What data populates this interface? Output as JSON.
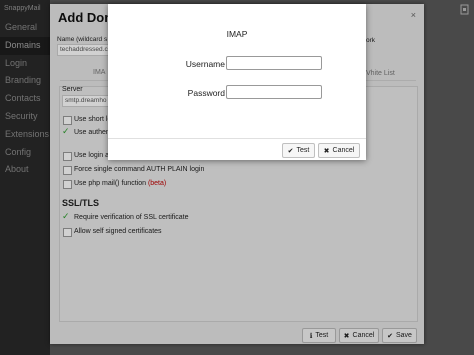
{
  "app": {
    "brand": "SnappyMail"
  },
  "sidebar": {
    "items": [
      {
        "label": "General"
      },
      {
        "label": "Domains"
      },
      {
        "label": "Login"
      },
      {
        "label": "Branding"
      },
      {
        "label": "Contacts"
      },
      {
        "label": "Security"
      },
      {
        "label": "Extensions"
      },
      {
        "label": "Config"
      },
      {
        "label": "About"
      }
    ]
  },
  "domain_dialog": {
    "title": "Add Doma",
    "close": "×",
    "name_label": "Name (wildcard s",
    "name_label_tail": "ork",
    "name_value": "techaddressed.c",
    "tab_left": "IMA",
    "tab_right": "Vhite List",
    "server_label": "Server",
    "server_value": "smtp.dreamho",
    "options": [
      {
        "label": "Use short lo",
        "checked": false
      },
      {
        "label": "Use authent",
        "checked": true
      },
      {
        "label": "Use login as",
        "checked": false
      },
      {
        "label": "Force single command AUTH PLAIN login",
        "checked": false
      },
      {
        "label": "Use php mail() function",
        "checked": false,
        "badge": "(beta)"
      }
    ],
    "ssl_heading": "SSL/TLS",
    "ssl_options": [
      {
        "label": "Require verification of SSL certificate",
        "checked": true
      },
      {
        "label": "Allow self signed certificates",
        "checked": false
      }
    ],
    "buttons": {
      "test": "Test",
      "cancel": "Cancel",
      "save": "Save"
    },
    "icons": {
      "test": "info-icon",
      "cancel": "close-icon",
      "save": "check-icon"
    }
  },
  "imap_modal": {
    "title": "IMAP",
    "username_label": "Username",
    "username_value": "",
    "password_label": "Password",
    "password_value": "",
    "buttons": {
      "test": "Test",
      "cancel": "Cancel"
    },
    "icons": {
      "test": "check-icon",
      "cancel": "close-icon"
    }
  },
  "colors": {
    "check_green": "#2f9e2f",
    "beta_red": "#c00000",
    "sidebar_bg": "#2a2a2a"
  }
}
